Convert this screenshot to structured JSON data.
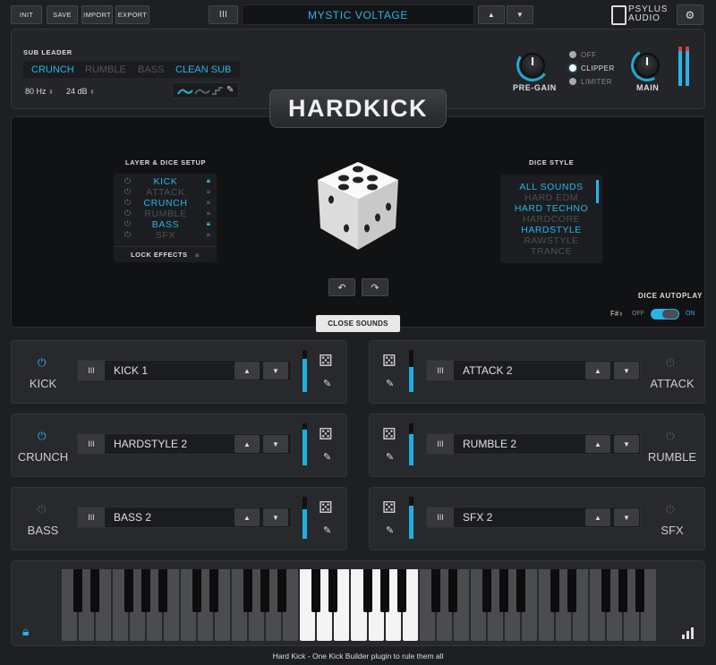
{
  "toolbar": {
    "init": "INIT",
    "save": "SAVE",
    "import": "IMPORT",
    "export": "EXPORT",
    "library_icon": "III",
    "preset_name": "MYSTIC VOLTAGE",
    "up": "▲",
    "down": "▼",
    "brand_line1": "PSYLUS",
    "brand_line2": "AUDIO",
    "settings_icon": "⚙"
  },
  "sub_leader": {
    "title": "SUB LEADER",
    "tabs": [
      "CRUNCH",
      "RUMBLE",
      "BASS",
      "CLEAN SUB"
    ],
    "active_tabs": [
      "CRUNCH",
      "CLEAN SUB"
    ],
    "freq": "80 Hz",
    "gain": "24 dB"
  },
  "output": {
    "pregain_label": "PRE-GAIN",
    "main_label": "MAIN",
    "modes": [
      "OFF",
      "CLIPPER",
      "LIMITER"
    ],
    "active_mode": "CLIPPER"
  },
  "logo": "HARDKICK",
  "layer_setup": {
    "title": "LAYER & DICE SETUP",
    "layers": [
      {
        "name": "KICK",
        "on": true
      },
      {
        "name": "ATTACK",
        "on": false
      },
      {
        "name": "CRUNCH",
        "on": true
      },
      {
        "name": "RUMBLE",
        "on": false
      },
      {
        "name": "BASS",
        "on": true
      },
      {
        "name": "SFX",
        "on": false
      }
    ],
    "lock_effects": "LOCK EFFECTS"
  },
  "dice_style": {
    "title": "DICE STYLE",
    "items": [
      {
        "name": "ALL SOUNDS",
        "on": true
      },
      {
        "name": "HARD EDM",
        "on": false
      },
      {
        "name": "HARD TECHNO",
        "on": true
      },
      {
        "name": "HARDCORE",
        "on": false
      },
      {
        "name": "HARDSTYLE",
        "on": true
      },
      {
        "name": "RAWSTYLE",
        "on": false
      },
      {
        "name": "TRANCE",
        "on": false
      }
    ]
  },
  "autoplay": {
    "title": "DICE AUTOPLAY",
    "key": "F#",
    "off": "OFF",
    "on": "ON",
    "enabled": true
  },
  "close_sounds": "CLOSE SOUNDS",
  "channels": {
    "kick": {
      "label": "KICK",
      "sample": "KICK 1",
      "level": 0.78
    },
    "crunch": {
      "label": "CRUNCH",
      "sample": "HARDSTYLE 2",
      "level": 0.85
    },
    "bass": {
      "label": "BASS",
      "sample": "BASS 2",
      "level": 0.7
    },
    "attack": {
      "label": "ATTACK",
      "sample": "ATTACK 2",
      "level": 0.6
    },
    "rumble": {
      "label": "RUMBLE",
      "sample": "RUMBLE 2",
      "level": 0.75
    },
    "sfx": {
      "label": "SFX",
      "sample": "SFX 2",
      "level": 0.78
    }
  },
  "footer": "Hard Kick - One Kick Builder plugin to rule them all",
  "colors": {
    "accent": "#2ab4e6",
    "bg": "#1d1f22"
  }
}
